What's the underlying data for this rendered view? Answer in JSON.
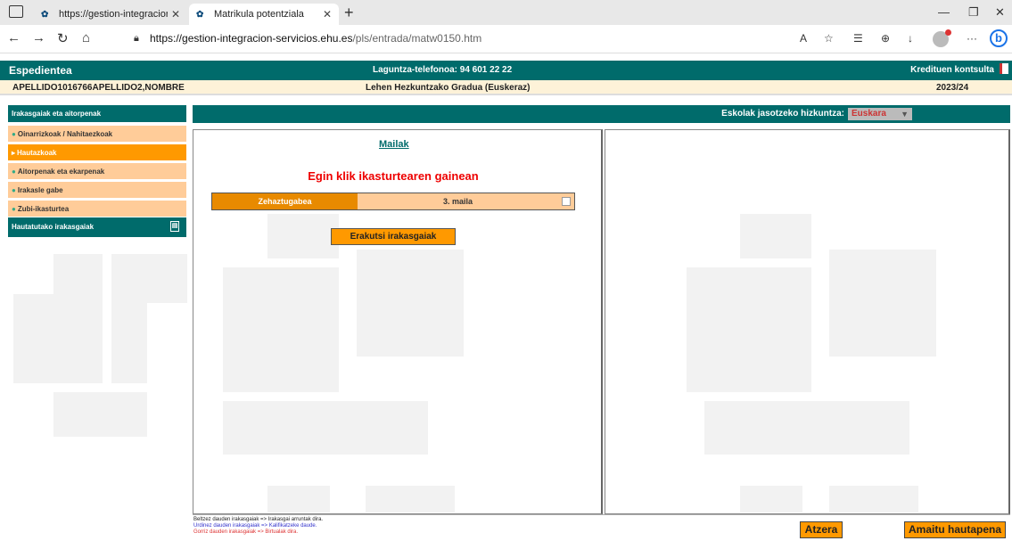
{
  "browser": {
    "tabs": [
      {
        "title": "https://gestion-integracion-servi",
        "active": false
      },
      {
        "title": "Matrikula potentziala",
        "active": true
      }
    ],
    "url_host": "https://gestion-integracion-servicios.ehu.es",
    "url_path": "/pls/entrada/matw0150.htm"
  },
  "header": {
    "title": "Espedientea",
    "phone": "Laguntza-telefonoa: 94 601 22 22",
    "credits_link": "Kredituen kontsulta"
  },
  "info": {
    "student": "APELLIDO1016766APELLIDO2,NOMBRE",
    "degree": "Lehen Hezkuntzako Gradua (Euskeraz)",
    "year": "2023/24"
  },
  "sidebar": {
    "header": "Irakasgaiak eta aitorpenak",
    "items": [
      {
        "label": "Oinarrizkoak / Nahitaezkoak",
        "active": false
      },
      {
        "label": "Hautazkoak",
        "active": true
      },
      {
        "label": "Aitorpenak eta ekarpenak",
        "active": false
      },
      {
        "label": "Irakasle gabe",
        "active": false
      },
      {
        "label": "Zubi-ikasturtea",
        "active": false
      }
    ],
    "selected_header": "Hautatutako irakasgaiak"
  },
  "language": {
    "label": "Eskolak jasotzeko hizkuntza:",
    "selected": "Euskara"
  },
  "main": {
    "mailak_link": "Mailak",
    "instruction": "Egin klik ikasturtearen gainean",
    "levels": [
      "Zehaztugabea",
      "3. maila"
    ],
    "show_button": "Erakutsi irakasgaiak"
  },
  "footer": {
    "legend": [
      "Beltzez dauden irakasgaiak => Irakasgai arruntak dira.",
      "Urdinez dauden irakasgaiak => Kalifikatzeke daude.",
      "Gorriz dauden irakasgaiak => Birtualak dira."
    ],
    "back_button": "Atzera",
    "finish_button": "Amaitu hautapena"
  }
}
